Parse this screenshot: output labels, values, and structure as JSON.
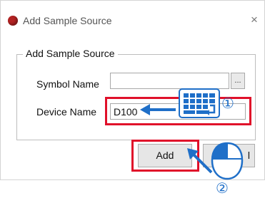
{
  "window": {
    "title": "Add Sample Source",
    "close_glyph": "×"
  },
  "group": {
    "label": "Add Sample Source"
  },
  "fields": {
    "symbol_label": "Symbol Name",
    "symbol_value": "",
    "browse_label": "...",
    "device_label": "Device Name",
    "device_value": "D100"
  },
  "buttons": {
    "add_label": "Add",
    "cancel_label": "l"
  },
  "annotations": {
    "step1": "①",
    "step2": "②"
  },
  "colors": {
    "highlight": "#e0102a",
    "annotation_blue": "#1f6fc8",
    "title_icon": "#b22222"
  },
  "icons": {
    "title": "app-red-dot-icon",
    "keyboard": "keyboard-icon",
    "arrow": "left-arrow-icon",
    "mouse": "mouse-icon",
    "click_arrow": "click-arrow-icon"
  }
}
